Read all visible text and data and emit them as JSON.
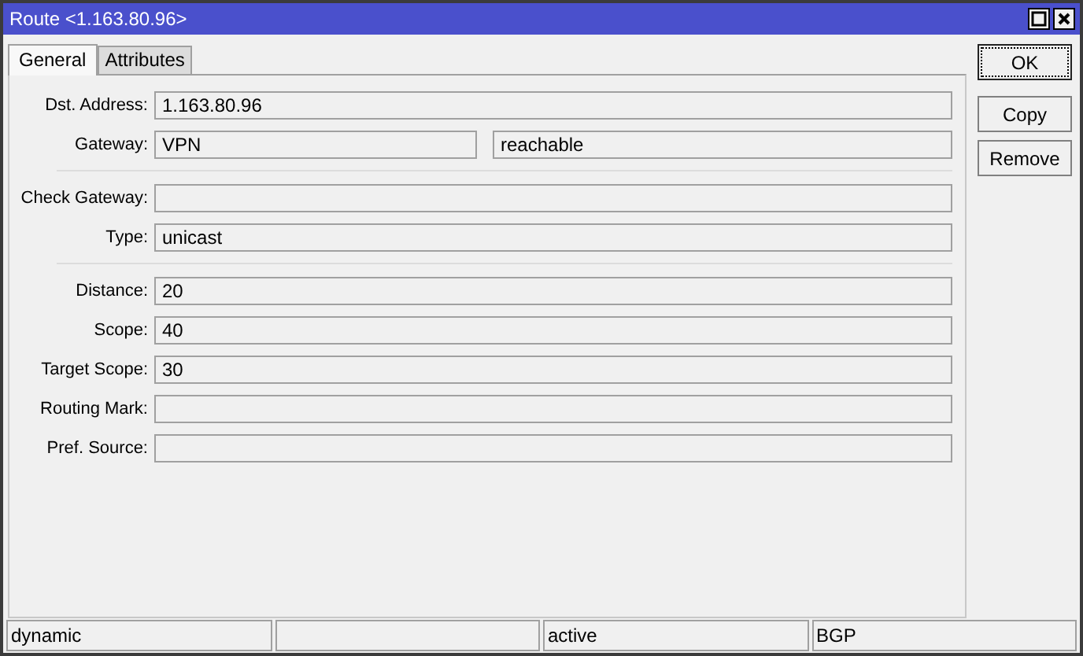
{
  "window": {
    "title": "Route <1.163.80.96>"
  },
  "tabs": [
    {
      "label": "General",
      "selected": true
    },
    {
      "label": "Attributes",
      "selected": false
    }
  ],
  "groups": [
    {
      "rows": [
        {
          "label": "Dst. Address:",
          "value": "1.163.80.96"
        },
        {
          "label": "Gateway:",
          "value": "VPN",
          "extra": "reachable"
        }
      ]
    },
    {
      "rows": [
        {
          "label": "Check Gateway:"
        },
        {
          "label": "Type:",
          "value": "unicast"
        }
      ]
    },
    {
      "rows": [
        {
          "label": "Distance:",
          "value": "20"
        },
        {
          "label": "Scope:",
          "value": "40"
        },
        {
          "label": "Target Scope:",
          "value": "30"
        },
        {
          "label": "Routing Mark:"
        },
        {
          "label": "Pref. Source:"
        }
      ]
    }
  ],
  "buttons": [
    {
      "label": "OK",
      "focused": true
    },
    {
      "label": "Copy",
      "focused": false
    },
    {
      "label": "Remove",
      "focused": false
    }
  ],
  "status_bar": [
    {
      "kind": "text",
      "text": "dynamic"
    },
    {
      "kind": "blank"
    },
    {
      "kind": "text",
      "text": "active"
    },
    {
      "kind": "text",
      "text": "BGP"
    }
  ]
}
